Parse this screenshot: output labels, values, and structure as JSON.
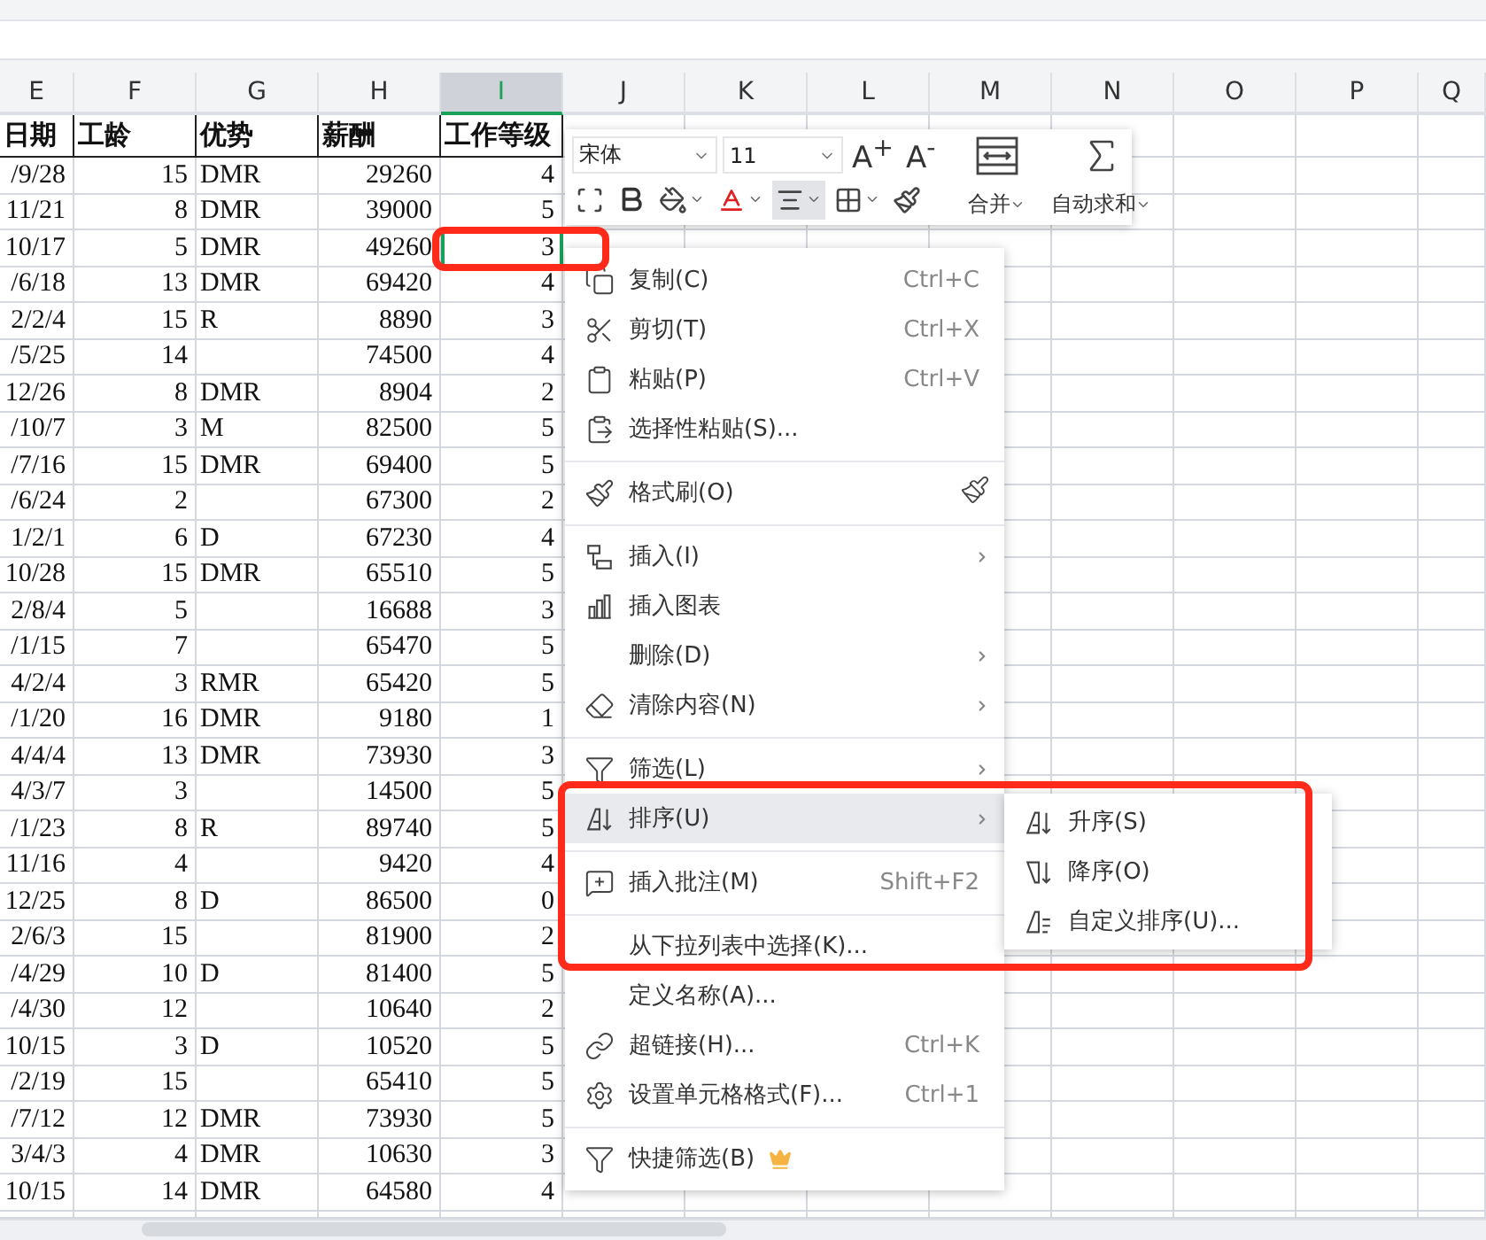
{
  "columns": [
    {
      "letter": "E",
      "selected": false
    },
    {
      "letter": "F",
      "selected": false
    },
    {
      "letter": "G",
      "selected": false
    },
    {
      "letter": "H",
      "selected": false
    },
    {
      "letter": "I",
      "selected": true
    },
    {
      "letter": "J",
      "selected": false
    },
    {
      "letter": "K",
      "selected": false
    },
    {
      "letter": "L",
      "selected": false
    },
    {
      "letter": "M",
      "selected": false
    },
    {
      "letter": "N",
      "selected": false
    },
    {
      "letter": "O",
      "selected": false
    },
    {
      "letter": "P",
      "selected": false
    },
    {
      "letter": "Q",
      "selected": false
    }
  ],
  "table": {
    "headers": [
      "日期",
      "工龄",
      "优势",
      "薪酬",
      "工作等级"
    ],
    "rows": [
      {
        "date": "/9/28",
        "years": "15",
        "strength": "DMR",
        "salary": "29260",
        "level": "4",
        "selected": false
      },
      {
        "date": "11/21",
        "years": "8",
        "strength": "DMR",
        "salary": "39000",
        "level": "5",
        "selected": false
      },
      {
        "date": "10/17",
        "years": "5",
        "strength": "DMR",
        "salary": "49260",
        "level": "3",
        "selected": true
      },
      {
        "date": "/6/18",
        "years": "13",
        "strength": "DMR",
        "salary": "69420",
        "level": "4",
        "selected": false
      },
      {
        "date": "2/2/4",
        "years": "15",
        "strength": "R",
        "salary": "8890",
        "level": "3",
        "selected": false
      },
      {
        "date": "/5/25",
        "years": "14",
        "salary": "74500",
        "level": "4",
        "selected": false
      },
      {
        "date": "12/26",
        "years": "8",
        "strength": "DMR",
        "salary": "8904",
        "level": "2",
        "selected": false
      },
      {
        "date": "/10/7",
        "years": "3",
        "strength": "M",
        "salary": "82500",
        "level": "5",
        "selected": false
      },
      {
        "date": "/7/16",
        "years": "15",
        "strength": "DMR",
        "salary": "69400",
        "level": "5",
        "selected": false
      },
      {
        "date": "/6/24",
        "years": "2",
        "salary": "67300",
        "level": "2",
        "selected": false
      },
      {
        "date": "1/2/1",
        "years": "6",
        "strength": "D",
        "salary": "67230",
        "level": "4",
        "selected": false
      },
      {
        "date": "10/28",
        "years": "15",
        "strength": "DMR",
        "salary": "65510",
        "level": "5",
        "selected": false
      },
      {
        "date": "2/8/4",
        "years": "5",
        "salary": "16688",
        "level": "3",
        "selected": false
      },
      {
        "date": "/1/15",
        "years": "7",
        "salary": "65470",
        "level": "5",
        "selected": false
      },
      {
        "date": "4/2/4",
        "years": "3",
        "strength": "RMR",
        "salary": "65420",
        "level": "5",
        "selected": false
      },
      {
        "date": "/1/20",
        "years": "16",
        "strength": "DMR",
        "salary": "9180",
        "level": "1",
        "selected": false
      },
      {
        "date": "4/4/4",
        "years": "13",
        "strength": "DMR",
        "salary": "73930",
        "level": "3",
        "selected": false
      },
      {
        "date": "4/3/7",
        "years": "3",
        "salary": "14500",
        "level": "5",
        "selected": false
      },
      {
        "date": "/1/23",
        "years": "8",
        "strength": "R",
        "salary": "89740",
        "level": "5",
        "selected": false
      },
      {
        "date": "11/16",
        "years": "4",
        "salary": "9420",
        "level": "4",
        "selected": false
      },
      {
        "date": "12/25",
        "years": "8",
        "strength": "D",
        "salary": "86500",
        "level": "0",
        "selected": false
      },
      {
        "date": "2/6/3",
        "years": "15",
        "salary": "81900",
        "level": "2",
        "selected": false
      },
      {
        "date": "/4/29",
        "years": "10",
        "strength": "D",
        "salary": "81400",
        "level": "5",
        "selected": false
      },
      {
        "date": "/4/30",
        "years": "12",
        "salary": "10640",
        "level": "2",
        "selected": false
      },
      {
        "date": "10/15",
        "years": "3",
        "strength": "D",
        "salary": "10520",
        "level": "5",
        "selected": false
      },
      {
        "date": "/2/19",
        "years": "15",
        "salary": "65410",
        "level": "5",
        "selected": false
      },
      {
        "date": "/7/12",
        "years": "12",
        "strength": "DMR",
        "salary": "73930",
        "level": "5",
        "selected": false
      },
      {
        "date": "3/4/3",
        "years": "4",
        "strength": "DMR",
        "salary": "10630",
        "level": "3",
        "selected": false
      },
      {
        "date": "10/15",
        "years": "14",
        "strength": "DMR",
        "salary": "64580",
        "level": "4",
        "selected": false
      }
    ]
  },
  "mini_toolbar": {
    "font": "宋体",
    "size": "11",
    "grow": "A$^{+}$",
    "shrink": "A$^{-}$",
    "align_selected": true,
    "merge": "合并",
    "autosum": "自动求和"
  },
  "context_menu": {
    "groups": [
      [
        {
          "label": "复制(C)",
          "shortcut": "Ctrl+C",
          "has_submenu": false,
          "selected": false
        },
        {
          "label": "剪切(T)",
          "shortcut": "Ctrl+X",
          "has_submenu": false,
          "selected": false
        },
        {
          "label": "粘贴(P)",
          "shortcut": "Ctrl+V",
          "has_submenu": false,
          "selected": false
        },
        {
          "label": "选择性粘贴(S)...",
          "has_submenu": false,
          "selected": false
        }
      ],
      [
        {
          "label": "格式刷(O)",
          "has_submenu": false,
          "selected": false
        }
      ],
      [
        {
          "label": "插入(I)",
          "has_submenu": true,
          "selected": false
        },
        {
          "label": "插入图表",
          "has_submenu": false,
          "selected": false
        },
        {
          "label": "删除(D)",
          "has_submenu": true,
          "selected": false
        },
        {
          "label": "清除内容(N)",
          "has_submenu": true,
          "selected": false
        }
      ],
      [
        {
          "label": "筛选(L)",
          "has_submenu": true,
          "selected": false
        },
        {
          "label": "排序(U)",
          "has_submenu": true,
          "selected": true
        }
      ],
      [
        {
          "label": "插入批注(M)",
          "shortcut": "Shift+F2",
          "has_submenu": false,
          "selected": false
        }
      ],
      [
        {
          "label": "从下拉列表中选择(K)...",
          "has_submenu": false,
          "selected": false
        },
        {
          "label": "定义名称(A)...",
          "has_submenu": false,
          "selected": false
        },
        {
          "label": "超链接(H)...",
          "shortcut": "Ctrl+K",
          "has_submenu": false,
          "selected": false
        },
        {
          "label": "设置单元格格式(F)...",
          "shortcut": "Ctrl+1",
          "has_submenu": false,
          "selected": false
        }
      ],
      [
        {
          "label": "快捷筛选(B)",
          "has_submenu": false,
          "selected": false
        }
      ]
    ]
  },
  "submenu": {
    "items": [
      {
        "label": "升序(S)"
      },
      {
        "label": "降序(O)"
      },
      {
        "label": "自定义排序(U)..."
      }
    ]
  }
}
